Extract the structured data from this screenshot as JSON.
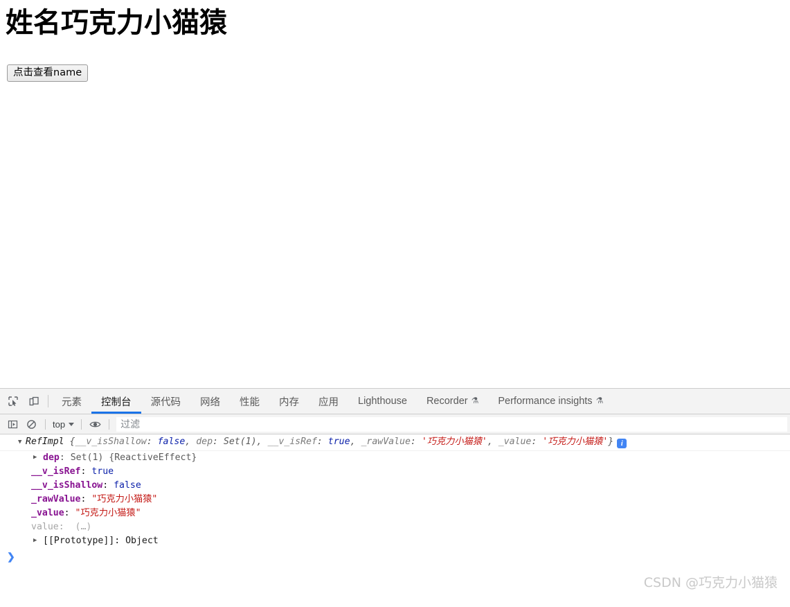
{
  "page": {
    "heading": "姓名巧克力小猫猿",
    "button_label": "点击查看name"
  },
  "devtools": {
    "toolbar_icons": {
      "inspect": "inspect-element-icon",
      "device": "device-toolbar-icon"
    },
    "tabs": [
      {
        "label": "元素",
        "active": false,
        "experimental": false
      },
      {
        "label": "控制台",
        "active": true,
        "experimental": false
      },
      {
        "label": "源代码",
        "active": false,
        "experimental": false
      },
      {
        "label": "网络",
        "active": false,
        "experimental": false
      },
      {
        "label": "性能",
        "active": false,
        "experimental": false
      },
      {
        "label": "内存",
        "active": false,
        "experimental": false
      },
      {
        "label": "应用",
        "active": false,
        "experimental": false
      },
      {
        "label": "Lighthouse",
        "active": false,
        "experimental": false
      },
      {
        "label": "Recorder",
        "active": false,
        "experimental": true
      },
      {
        "label": "Performance insights",
        "active": false,
        "experimental": true
      }
    ],
    "experimental_glyph": "⚗",
    "console_toolbar": {
      "sidebar_toggle_icon": "console-sidebar-icon",
      "clear_icon": "clear-console-icon",
      "context": "top",
      "eye_icon": "live-expression-eye-icon",
      "filter_placeholder": "过滤",
      "filter_value": ""
    },
    "console_output": {
      "summary": {
        "constructor": "RefImpl",
        "open_brace": "{",
        "close_brace": "}",
        "entries": [
          {
            "key": "__v_isShallow",
            "value": "false",
            "kind": "bool"
          },
          {
            "key": "dep",
            "value": "Set(1)",
            "kind": "obj"
          },
          {
            "key": "__v_isRef",
            "value": "true",
            "kind": "bool"
          },
          {
            "key": "_rawValue",
            "value": "'巧克力小猫猿'",
            "kind": "str"
          },
          {
            "key": "_value",
            "value": "'巧克力小猫猿'",
            "kind": "str"
          }
        ],
        "info_badge": "i"
      },
      "properties": [
        {
          "name": "dep",
          "value": "Set(1) {ReactiveEffect}",
          "kind": "obj",
          "expandable": true,
          "getter": false
        },
        {
          "name": "__v_isRef",
          "value": "true",
          "kind": "bool",
          "expandable": false,
          "getter": false
        },
        {
          "name": "__v_isShallow",
          "value": "false",
          "kind": "bool",
          "expandable": false,
          "getter": false
        },
        {
          "name": "_rawValue",
          "value": "\"巧克力小猫猿\"",
          "kind": "str",
          "expandable": false,
          "getter": false
        },
        {
          "name": "_value",
          "value": "\"巧克力小猫猿\"",
          "kind": "str",
          "expandable": false,
          "getter": false
        },
        {
          "name": "value",
          "value": "(…)",
          "kind": "grey",
          "expandable": false,
          "getter": true
        },
        {
          "name": "[[Prototype]]",
          "value": "Object",
          "kind": "dark",
          "expandable": true,
          "getter": false
        }
      ],
      "prompt_chevron": "❯"
    }
  },
  "watermark": "CSDN @巧克力小猫猿",
  "colors": {
    "accent": "#1a73e8",
    "property_name": "#881391",
    "string_value": "#c41a16",
    "boolean_value": "#0d22aa",
    "info_badge": "#4285f4"
  }
}
